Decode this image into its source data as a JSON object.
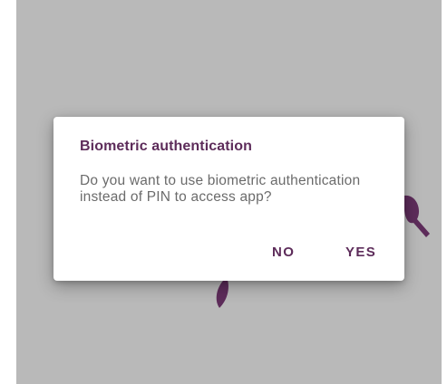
{
  "dialog": {
    "title": "Biometric authentication",
    "message": "Do you want to use biometric authentication instead of PIN to access app?",
    "negative_label": "NO",
    "positive_label": "YES"
  },
  "colors": {
    "scrim": "#b9b9b9",
    "accent": "#5d2c5a",
    "dialog_background": "#ffffff",
    "message_text": "#6b6b6b"
  },
  "background_icons": [
    "leaf-icon",
    "magnifier-icon"
  ]
}
